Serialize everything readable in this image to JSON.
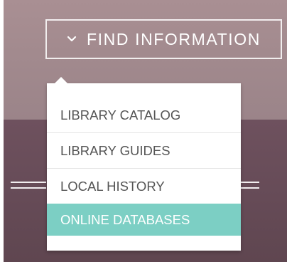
{
  "nav": {
    "button_label": "FIND INFORMATION",
    "button_icon": "chevron-down-icon"
  },
  "menu": {
    "items": [
      {
        "label": "LIBRARY CATALOG"
      },
      {
        "label": "LIBRARY GUIDES"
      },
      {
        "label": "LOCAL HISTORY"
      },
      {
        "label": "ONLINE DATABASES",
        "highlighted": true
      }
    ],
    "highlight_color": "#7ccfc4",
    "text_color": "#555555"
  },
  "colors": {
    "upper_background": "#a28a8e",
    "lower_background": "#664b57"
  }
}
